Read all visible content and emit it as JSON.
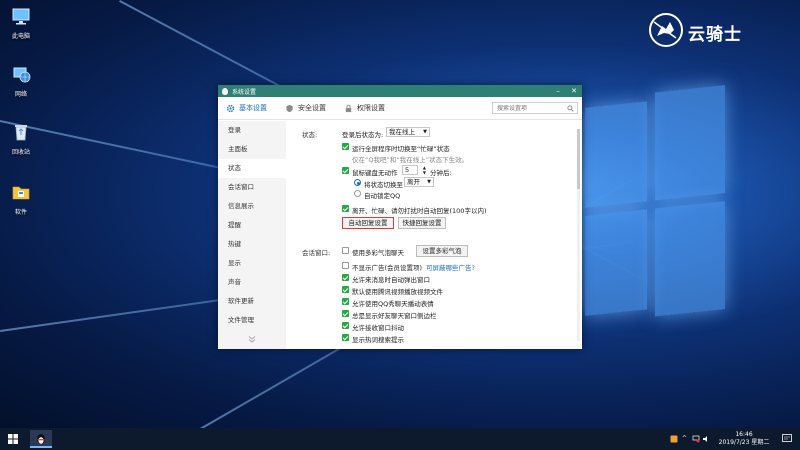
{
  "desktop": {
    "icons": [
      {
        "label": "此电脑"
      },
      {
        "label": "网络"
      },
      {
        "label": "回收站"
      },
      {
        "label": "软件"
      }
    ],
    "brand": "云骑士"
  },
  "window": {
    "title": "系统设置",
    "tabs": [
      {
        "label": "基本设置",
        "icon": "gear-icon"
      },
      {
        "label": "安全设置",
        "icon": "shield-icon"
      },
      {
        "label": "权限设置",
        "icon": "lock-icon"
      }
    ],
    "search_placeholder": "搜索设置项",
    "sidebar": [
      "登录",
      "主面板",
      "状态",
      "会话窗口",
      "信息展示",
      "提醒",
      "热键",
      "显示",
      "声音",
      "软件更新",
      "文件管理"
    ],
    "status": {
      "section_label": "状态:",
      "after_login_label": "登录后状态为:",
      "after_login_value": "我在线上",
      "fullscreen_label": "运行全屏程序时切换至“忙碌”状态",
      "fullscreen_hint": "仅在“Q我吧”和“我在线上”状态下生效。",
      "idle_label": "鼠标键盘无动作",
      "idle_minutes": "5",
      "idle_unit": "分钟后:",
      "radio_switch_label": "将状态切换至",
      "radio_switch_value": "离开",
      "radio_lock_label": "自动锁定QQ",
      "auto_reply_label": "离开、忙碌、请勿打扰时自动回复(100字以内)",
      "auto_reply_button": "自动回复设置",
      "quick_reply_button": "快捷回复设置"
    },
    "session": {
      "section_label": "会话窗口:",
      "bubble_label": "使用多彩气泡聊天",
      "bubble_button": "设置多彩气泡",
      "ad_label": "不显示广告(会员设置项)",
      "ad_link": "可屏蔽哪些广告?",
      "options": [
        "允许来消息时自动弹出窗口",
        "默认使用腾讯视频播放视频文件",
        "允许使用QQ秀聊天播动表情",
        "总是显示好友聊天窗口侧边栏",
        "允许接收窗口抖动",
        "显示热词搜索提示"
      ]
    }
  },
  "taskbar": {
    "time": "16:46",
    "date": "2019/7/23 星期二"
  },
  "colors": {
    "titlebar": "#2e7f74",
    "accent": "#1a6fc7",
    "checkbox_on": "#27a745",
    "highlight_border": "#e23a3a"
  }
}
